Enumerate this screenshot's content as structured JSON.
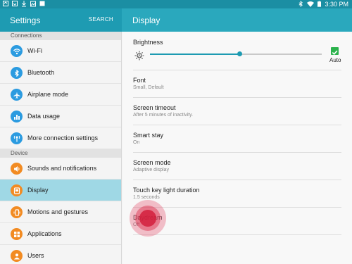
{
  "status_bar": {
    "left_icons": [
      "notification-icon",
      "notification-icon",
      "download-icon",
      "image-icon",
      "notification-icon"
    ],
    "right_icons": [
      "bluetooth-icon",
      "wifi-icon",
      "battery-icon"
    ],
    "time": "3:30 PM"
  },
  "left_header": {
    "title": "Settings",
    "search_label": "SEARCH"
  },
  "right_header": {
    "title": "Display"
  },
  "sidebar": {
    "sections": [
      {
        "header": "Connections",
        "items": [
          {
            "label": "Wi-Fi",
            "icon": "wifi-icon",
            "color": "#2b9be0"
          },
          {
            "label": "Bluetooth",
            "icon": "bluetooth-icon",
            "color": "#2b9be0"
          },
          {
            "label": "Airplane mode",
            "icon": "airplane-icon",
            "color": "#2b9be0"
          },
          {
            "label": "Data usage",
            "icon": "data-usage-icon",
            "color": "#2b9be0"
          },
          {
            "label": "More connection settings",
            "icon": "connection-settings-icon",
            "color": "#2b9be0"
          }
        ]
      },
      {
        "header": "Device",
        "items": [
          {
            "label": "Sounds and notifications",
            "icon": "sound-icon",
            "color": "#f28b22"
          },
          {
            "label": "Display",
            "icon": "display-icon",
            "color": "#f28b22",
            "selected": true
          },
          {
            "label": "Motions and gestures",
            "icon": "motion-icon",
            "color": "#f28b22"
          },
          {
            "label": "Applications",
            "icon": "applications-icon",
            "color": "#f28b22"
          },
          {
            "label": "Users",
            "icon": "users-icon",
            "color": "#f28b22"
          }
        ]
      }
    ]
  },
  "display_settings": {
    "brightness": {
      "label": "Brightness",
      "level_percent": 52,
      "auto_label": "Auto",
      "auto_checked": true
    },
    "items": [
      {
        "title": "Font",
        "subtitle": "Small, Default"
      },
      {
        "title": "Screen timeout",
        "subtitle": "After 5 minutes of inactivity."
      },
      {
        "title": "Smart stay",
        "subtitle": "On"
      },
      {
        "title": "Screen mode",
        "subtitle": "Adaptive display"
      },
      {
        "title": "Touch key light duration",
        "subtitle": "1.5 seconds"
      },
      {
        "title": "Daydream",
        "subtitle": "Off"
      }
    ]
  },
  "colors": {
    "header_dark": "#1e9bb2",
    "header_light": "#2aa8bd",
    "selected_row": "#9fd8e5",
    "accent_green": "#2bb24c"
  }
}
